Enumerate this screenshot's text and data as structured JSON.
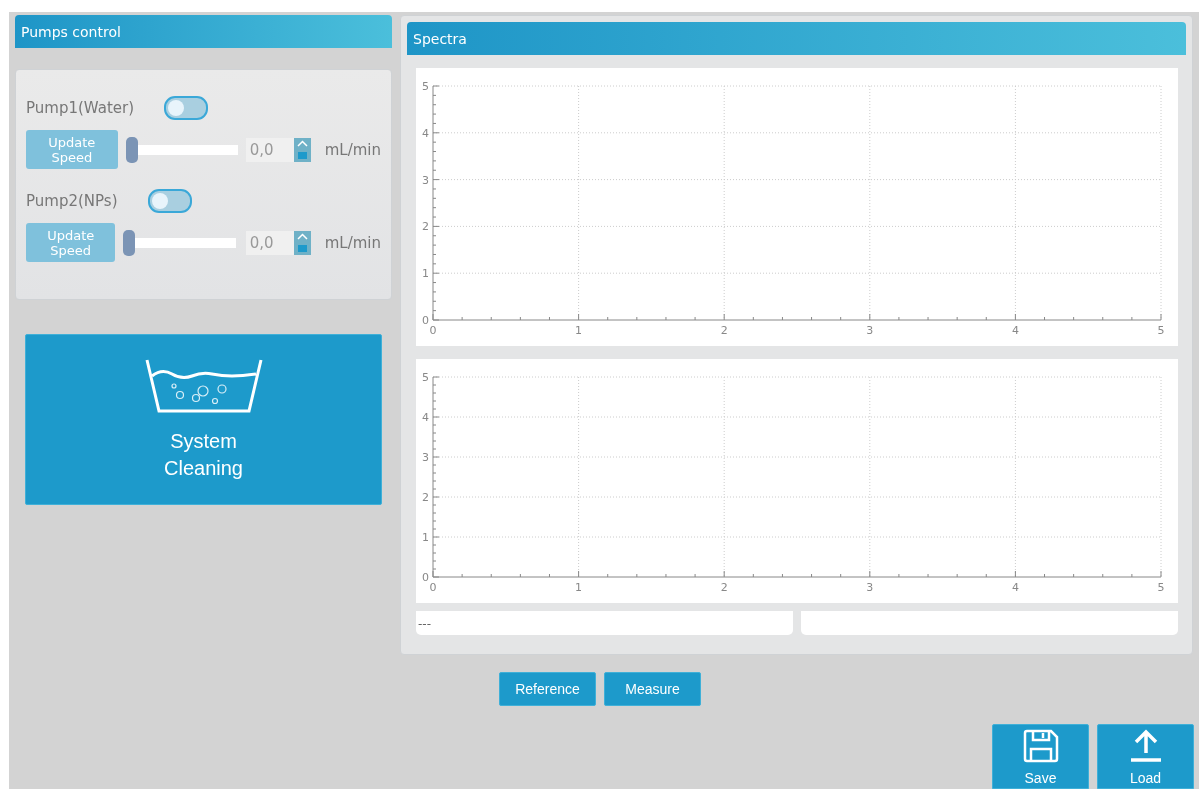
{
  "pumps_panel": {
    "title": "Pumps control",
    "pumps": [
      {
        "name": "Pump1(Water)",
        "on": false,
        "button": "Update Speed",
        "level": 0,
        "value": "0,0",
        "unit": "mL/min"
      },
      {
        "name": "Pump2(NPs)",
        "on": false,
        "button": "Update Speed",
        "level": 0,
        "value": "0,0",
        "unit": "mL/min"
      }
    ]
  },
  "cleaning_button": {
    "label": "System Cleaning"
  },
  "spectra_panel": {
    "title": "Spectra",
    "charts": [
      {
        "chart_data": {
          "type": "line",
          "grid": true,
          "xlim": [
            0,
            5
          ],
          "ylim": [
            0,
            5
          ],
          "xticks": [
            0,
            1,
            2,
            3,
            4,
            5
          ],
          "yticks": [
            0,
            1,
            2,
            3,
            4,
            5
          ]
        }
      },
      {
        "chart_data": {
          "type": "line",
          "grid": true,
          "xlim": [
            0,
            5
          ],
          "ylim": [
            0,
            5
          ],
          "xticks": [
            0,
            1,
            2,
            3,
            4,
            5
          ],
          "yticks": [
            0,
            1,
            2,
            3,
            4,
            5
          ]
        }
      }
    ],
    "status_fields": [
      "---"
    ]
  },
  "measure_buttons": [
    "Reference",
    "Measure"
  ],
  "file_buttons": [
    {
      "kind": "save",
      "label": "Save"
    },
    {
      "kind": "load",
      "label": "Load"
    }
  ]
}
